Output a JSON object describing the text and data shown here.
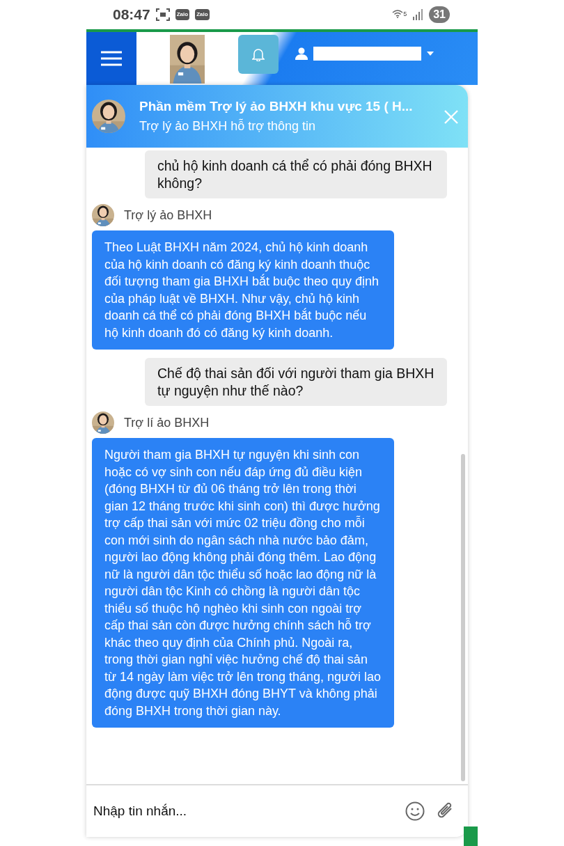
{
  "status_bar": {
    "time": "08:47",
    "app_badges": [
      "Zalo",
      "Zalo"
    ],
    "wifi_label": "5",
    "battery": "31"
  },
  "chat": {
    "title": "Phần mềm Trợ lý ảo BHXH khu vực 15 ( H...",
    "subtitle": "Trợ lý ảo BHXH hỗ trợ thông tin",
    "messages": [
      {
        "kind": "user",
        "text": "chủ hộ kinh doanh cá thể có phải đóng BHXH không?"
      },
      {
        "kind": "bot",
        "sender": "Trợ lý ảo BHXH",
        "text": "Theo Luật BHXH năm 2024, chủ hộ kinh doanh của hộ kinh doanh có đăng ký kinh doanh thuộc đối tượng tham gia BHXH bắt buộc theo quy định của pháp luật về BHXH. Như vậy, chủ hộ kinh doanh cá thể có phải đóng BHXH bắt buộc nếu hộ kinh doanh đó có đăng ký kinh doanh."
      },
      {
        "kind": "user",
        "text": "Chế độ thai sản đối với người tham gia BHXH tự nguyện như thế nào?"
      },
      {
        "kind": "bot",
        "sender": "Trợ lí ảo BHXH",
        "text": "Người tham gia BHXH tự nguyện khi sinh con hoặc có vợ sinh con nếu đáp ứng đủ điều kiện (đóng BHXH từ đủ 06 tháng trở lên trong thời gian 12 tháng trước khi sinh con) thì được hưởng trợ cấp thai sản với mức 02 triệu đồng cho mỗi con mới sinh do ngân sách nhà nước bảo đảm, người lao động không phải đóng thêm. Lao động nữ là người dân tộc thiểu số hoặc lao động nữ là người dân tộc Kinh có chồng là người dân tộc thiểu số thuộc hộ nghèo khi sinh con ngoài trợ cấp thai sản còn được hưởng chính sách hỗ trợ khác theo quy định của Chính phủ. Ngoài ra, trong thời gian nghỉ việc hưởng chế độ thai sản từ 14 ngày làm việc trở lên trong tháng, người lao động được quỹ BHXH đóng BHYT và không phải đóng BHXH trong thời gian này."
      }
    ],
    "input": {
      "placeholder": "Nhập tin nhắn..."
    }
  }
}
